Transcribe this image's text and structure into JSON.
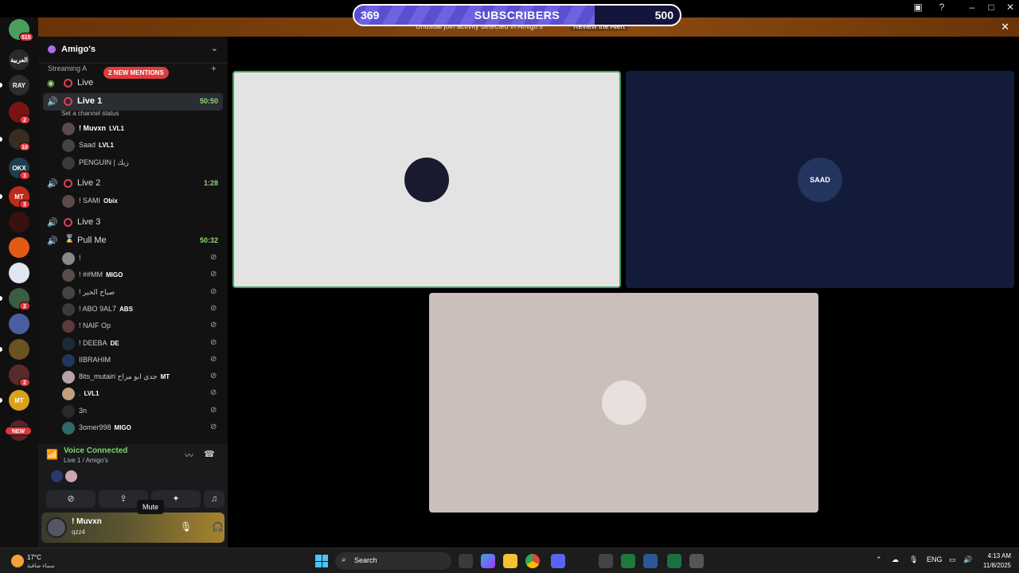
{
  "subscribers": {
    "current": "369",
    "label": "SUBSCRIBERS",
    "goal": "500",
    "progress": 0.738
  },
  "banner": {
    "message": "Unusual join activity detected in Amigo's",
    "action": "Review the Alert"
  },
  "rail": {
    "servers": [
      {
        "label": "",
        "badge": "515",
        "color": "#4a9e5c"
      },
      {
        "label": "العربية",
        "badge": "",
        "color": "#2a2a2a"
      },
      {
        "label": "RAY",
        "badge": "",
        "color": "#2e2e2e"
      },
      {
        "label": "",
        "badge": "2",
        "color": "#7a1414"
      },
      {
        "label": "",
        "badge": "10",
        "color": "#3a2c20"
      },
      {
        "label": "OKX",
        "badge": "3",
        "color": "#1f3d4f"
      },
      {
        "label": "MT",
        "badge": "3",
        "color": "#c02a1a"
      },
      {
        "label": "",
        "badge": "",
        "color": "#3a1010"
      },
      {
        "label": "",
        "badge": "",
        "color": "#e05a14"
      },
      {
        "label": "",
        "badge": "",
        "color": "#dfe6f0"
      },
      {
        "label": "",
        "badge": "2",
        "color": "#3a5d44"
      },
      {
        "label": "",
        "badge": "",
        "color": "#4a5ea0"
      },
      {
        "label": "",
        "badge": "",
        "color": "#6a5222"
      },
      {
        "label": "",
        "badge": "2",
        "color": "#5a2a2a"
      },
      {
        "label": "MT",
        "badge": "",
        "color": "#d8a21a"
      },
      {
        "label": "",
        "badge": "NEW",
        "color": "#5a2222"
      }
    ]
  },
  "sidebar": {
    "server_name": "Amigo's",
    "category": "Streaming A",
    "mentions": "2 NEW MENTIONS",
    "channels": [
      {
        "name": "Live",
        "time": ""
      },
      {
        "name": "Live 1",
        "time": "50:50"
      },
      {
        "name": "Live 2",
        "time": "1:28"
      },
      {
        "name": "Live 3",
        "time": ""
      },
      {
        "name": "Pull Me",
        "time": "50:32"
      }
    ],
    "status_text": "Set a channel status",
    "live1_users": [
      {
        "name": "! Muvxn",
        "tag": "LVL1"
      },
      {
        "name": "Saad",
        "tag": "LVL1"
      },
      {
        "name": "PENGUIN | زيك",
        "tag": ""
      }
    ],
    "live2_users": [
      {
        "name": "! SAMI",
        "tag": "Obix"
      }
    ],
    "pull_users": [
      {
        "name": "!",
        "tag": ""
      },
      {
        "name": "! ##MM",
        "tag": "MIGO"
      },
      {
        "name": "! صباح الخير",
        "tag": ""
      },
      {
        "name": "! ABO 9AL7",
        "tag": "ABS"
      },
      {
        "name": "! NAIF Op",
        "tag": ""
      },
      {
        "name": "! DEEBA",
        "tag": "DE"
      },
      {
        "name": "IIBRAHIM",
        "tag": ""
      },
      {
        "name": "8its_mutairi جدي ابو مزاح",
        "tag": "MT"
      },
      {
        "name": ".",
        "tag": "LVL1"
      },
      {
        "name": "3n",
        "tag": ""
      },
      {
        "name": "3omer998",
        "tag": "MIGO"
      }
    ]
  },
  "voice": {
    "title": "Voice Connected",
    "subtitle": "Live 1 / Amigo's",
    "tooltip": "Mute"
  },
  "user": {
    "name": "! Muvxn",
    "tag": "qzz4"
  },
  "stage": {
    "tiles": [
      {
        "label": "",
        "bg": "#e3e3e3",
        "border": "#3ba55d",
        "avatar": "#1a1a2e"
      },
      {
        "label": "SAAD",
        "bg": "#121c3a",
        "border": "",
        "avatar": "#23355e"
      },
      {
        "label": "",
        "bg": "#cbbfbc",
        "border": "",
        "avatar": "#e8e0dc"
      }
    ]
  },
  "taskbar": {
    "temp": "17°C",
    "condition": "سماء صافية",
    "search": "Search",
    "lang": "ENG",
    "time": "4:13 AM",
    "date": "11/8/2025"
  }
}
